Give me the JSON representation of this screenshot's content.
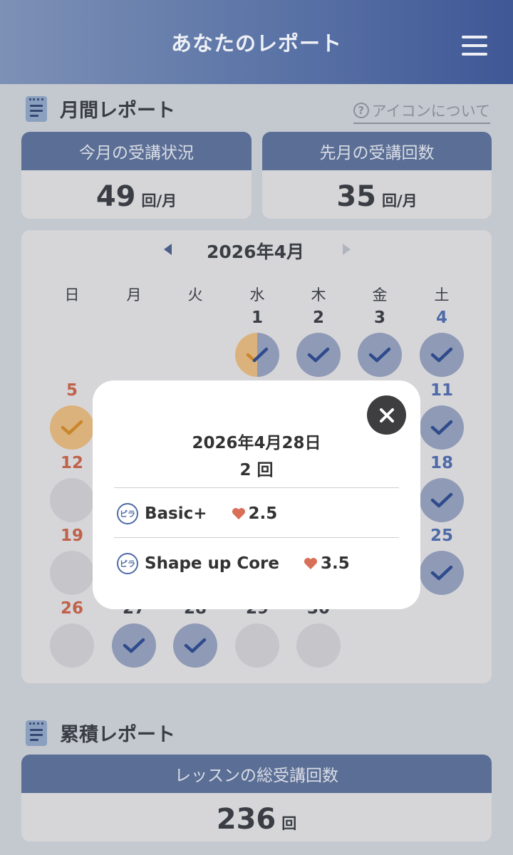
{
  "header": {
    "title": "あなたのレポート",
    "menu_icon": "hamburger-menu-icon"
  },
  "monthly": {
    "section_title": "月間レポート",
    "about_icons_link": "アイコンについて",
    "this_month": {
      "label": "今月の受講状況",
      "value": "49",
      "unit": "回/月"
    },
    "last_month": {
      "label": "先月の受講回数",
      "value": "35",
      "unit": "回/月"
    }
  },
  "calendar": {
    "title": "2026年4月",
    "weekdays": [
      "日",
      "月",
      "火",
      "水",
      "木",
      "金",
      "土"
    ],
    "days": [
      {
        "d": "1",
        "status": "half"
      },
      {
        "d": "2",
        "status": "done"
      },
      {
        "d": "3",
        "status": "done"
      },
      {
        "d": "4",
        "status": "done"
      },
      {
        "d": "5",
        "status": "orange"
      },
      {
        "d": "11",
        "status": "done"
      },
      {
        "d": "12",
        "status": "empty"
      },
      {
        "d": "18",
        "status": "done"
      },
      {
        "d": "19",
        "status": "empty"
      },
      {
        "d": "25",
        "status": "done"
      },
      {
        "d": "26",
        "status": "empty"
      },
      {
        "d": "27",
        "status": "done"
      },
      {
        "d": "28",
        "status": "done"
      },
      {
        "d": "29",
        "status": "empty"
      },
      {
        "d": "30",
        "status": "empty"
      }
    ],
    "colors": {
      "sunday": "#c0624a",
      "saturday": "#4f6aa8",
      "weekday": "#3a3d44"
    }
  },
  "popup": {
    "date": "2026年4月28日",
    "count": "2 回",
    "lessons": [
      {
        "icon_label": "ピラ",
        "name": "Basic+",
        "score": "2.5"
      },
      {
        "icon_label": "ピラ",
        "name": "Shape up Core",
        "score": "3.5"
      }
    ]
  },
  "cumulative": {
    "section_title": "累積レポート",
    "total": {
      "label": "レッスンの総受講回数",
      "value": "236",
      "unit": "回"
    }
  }
}
